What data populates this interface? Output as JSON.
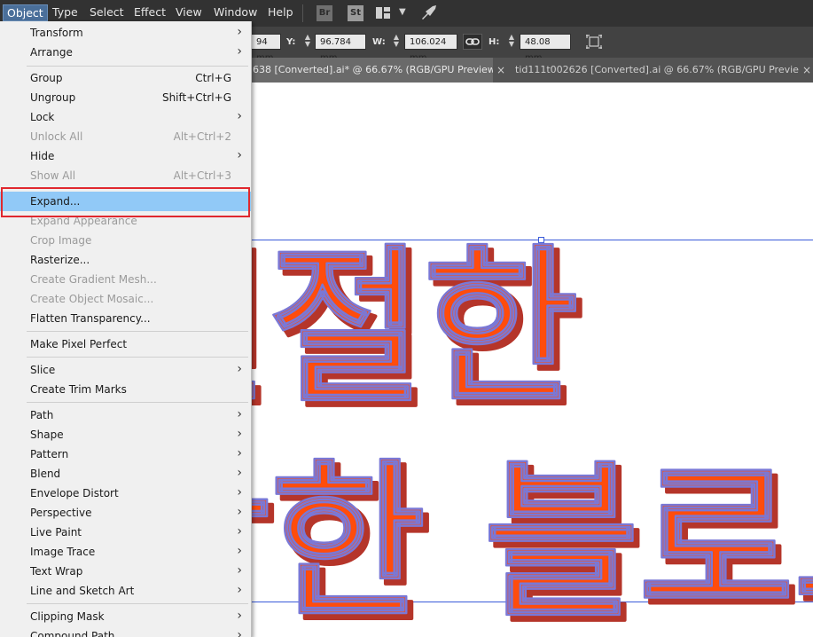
{
  "menubar": {
    "items": [
      "Object",
      "Type",
      "Select",
      "Effect",
      "View",
      "Window",
      "Help"
    ],
    "bridge_label": "Br",
    "stock_label": "St"
  },
  "control": {
    "x_value": "94 mm",
    "y_label": "Y:",
    "y_value": "96.784 mm",
    "w_label": "W:",
    "w_value": "106.024 mm",
    "h_label": "H:",
    "h_value": "48.08 mm"
  },
  "tabs": [
    "638 [Converted].ai* @ 66.67% (RGB/GPU Preview)",
    "tid111t002626 [Converted].ai @ 66.67% (RGB/GPU Preview)"
  ],
  "tab_close_glyph": "×",
  "menu": {
    "items": [
      {
        "label": "Transform",
        "submenu": true
      },
      {
        "label": "Arrange",
        "submenu": true
      },
      {
        "label": "Group",
        "shortcut": "Ctrl+G"
      },
      {
        "label": "Ungroup",
        "shortcut": "Shift+Ctrl+G"
      },
      {
        "label": "Lock",
        "submenu": true
      },
      {
        "label": "Unlock All",
        "shortcut": "Alt+Ctrl+2",
        "disabled": true
      },
      {
        "label": "Hide",
        "submenu": true
      },
      {
        "label": "Show All",
        "shortcut": "Alt+Ctrl+3",
        "disabled": true
      },
      {
        "label": "Expand...",
        "highlighted": true
      },
      {
        "label": "Expand Appearance",
        "disabled": true
      },
      {
        "label": "Crop Image",
        "disabled": true
      },
      {
        "label": "Rasterize..."
      },
      {
        "label": "Create Gradient Mesh...",
        "disabled": true
      },
      {
        "label": "Create Object Mosaic...",
        "disabled": true
      },
      {
        "label": "Flatten Transparency..."
      },
      {
        "label": "Make Pixel Perfect"
      },
      {
        "label": "Slice",
        "submenu": true
      },
      {
        "label": "Create Trim Marks"
      },
      {
        "label": "Path",
        "submenu": true
      },
      {
        "label": "Shape",
        "submenu": true
      },
      {
        "label": "Pattern",
        "submenu": true
      },
      {
        "label": "Blend",
        "submenu": true
      },
      {
        "label": "Envelope Distort",
        "submenu": true
      },
      {
        "label": "Perspective",
        "submenu": true
      },
      {
        "label": "Live Paint",
        "submenu": true
      },
      {
        "label": "Image Trace",
        "submenu": true
      },
      {
        "label": "Text Wrap",
        "submenu": true
      },
      {
        "label": "Line and Sketch Art",
        "submenu": true
      },
      {
        "label": "Clipping Mask",
        "submenu": true
      },
      {
        "label": "Compound Path",
        "submenu": true
      }
    ],
    "submenu_glyph": "›"
  },
  "artwork": {
    "line1": "친절한",
    "line2": "착한 블로그",
    "fill_color": "#ff4c0c",
    "shadow_color": "#b5352a",
    "outline_color": "#7a78d6"
  }
}
